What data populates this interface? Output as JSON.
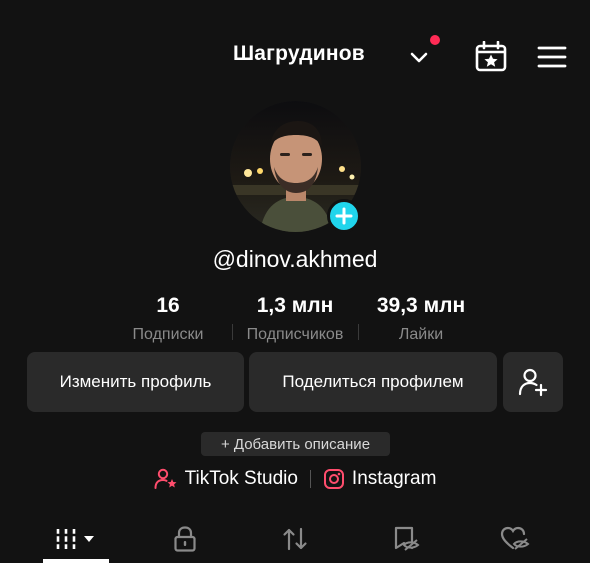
{
  "header": {
    "title": "Шагрудинов",
    "icons": [
      "chevron-down-icon",
      "notification-dot",
      "calendar-star-icon",
      "menu-icon"
    ],
    "accent_color": "#ff2b55"
  },
  "profile": {
    "handle": "@dinov.akhmed",
    "avatar_add_color": "#20d5ec"
  },
  "stats": [
    {
      "value": "16",
      "label": "Подписки"
    },
    {
      "value": "1,3 млн",
      "label": "Подписчиков"
    },
    {
      "value": "39,3 млн",
      "label": "Лайки"
    }
  ],
  "actions": {
    "edit_profile": "Изменить профиль",
    "share_profile": "Поделиться профилем"
  },
  "description_button": "+ Добавить описание",
  "links": {
    "studio": "TikTok Studio",
    "instagram": "Instagram"
  },
  "tabs": [
    "videos-grid",
    "private",
    "reposts",
    "favorites",
    "liked"
  ]
}
